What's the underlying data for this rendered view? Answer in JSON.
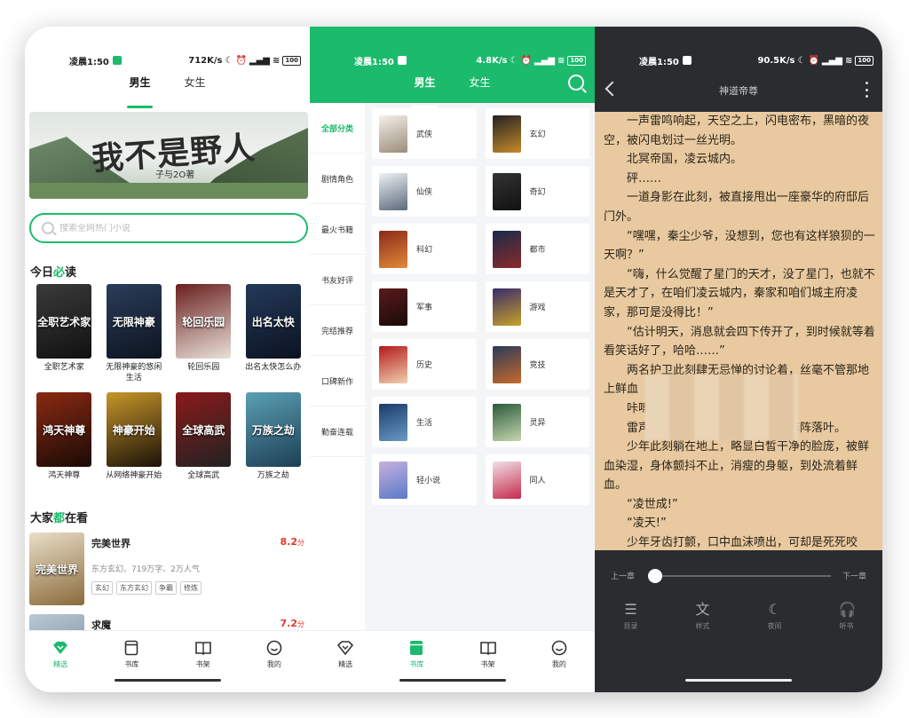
{
  "colors": {
    "accent": "#1cba6c",
    "score": "#e0392b",
    "reader_bg": "#e8c9a0",
    "reader_dark": "#2a2c30"
  },
  "panel1": {
    "status": {
      "time": "凌晨1:50",
      "speed": "712K/s",
      "battery": "100"
    },
    "tabs": [
      "男生",
      "女生"
    ],
    "banner": {
      "title": "我不是野人",
      "subtitle": "子与2O著"
    },
    "search_placeholder": "搜索全网热门小说",
    "today_title_a": "今日",
    "today_title_b": "必",
    "today_title_c": "读",
    "books": [
      {
        "name": "全职艺术家",
        "cover_text": "全职艺术家",
        "color1": "#3a3a3a",
        "color2": "#111111"
      },
      {
        "name": "无限神豪的悠闲生活",
        "cover_text": "无限神豪",
        "color1": "#2a3d5a",
        "color2": "#0d1420"
      },
      {
        "name": "轮回乐园",
        "cover_text": "轮回乐园",
        "color1": "#6a1f1f",
        "color2": "#e9e1d8"
      },
      {
        "name": "出名太快怎么办",
        "cover_text": "出名太快",
        "color1": "#243a5a",
        "color2": "#0a1220"
      },
      {
        "name": "鸿天神尊",
        "cover_text": "鸿天神尊",
        "color1": "#8a2a12",
        "color2": "#1a0a05"
      },
      {
        "name": "从网络神豪开始",
        "cover_text": "神豪开始",
        "color1": "#c7962a",
        "color2": "#1a1208"
      },
      {
        "name": "全球高武",
        "cover_text": "全球高武",
        "color1": "#8a1a1a",
        "color2": "#222222"
      },
      {
        "name": "万族之劫",
        "cover_text": "万族之劫",
        "color1": "#5aa0b4",
        "color2": "#1d3f55"
      }
    ],
    "everyone_title_a": "大家",
    "everyone_title_b": "都",
    "everyone_title_c": "在看",
    "hot": [
      {
        "title": "完美世界",
        "score": "8.2",
        "unit": "分",
        "meta": "东方玄幻、719万字、2万人气",
        "tags": [
          "玄幻",
          "东方玄幻",
          "争霸",
          "修炼"
        ],
        "cover_text": "完美世界",
        "color1": "#e9dfc8",
        "color2": "#8a6a3a"
      },
      {
        "title": "求魔",
        "score": "7.2",
        "unit": "分",
        "meta": "",
        "tags": [],
        "cover_text": "求魔",
        "color1": "#b9c9d6",
        "color2": "#6a7a8a"
      }
    ],
    "nav": [
      "精选",
      "书库",
      "书架",
      "我的"
    ]
  },
  "panel2": {
    "status": {
      "time": "凌晨1:50",
      "speed": "4.8K/s",
      "battery": "100"
    },
    "tabs": [
      "男生",
      "女生"
    ],
    "side": [
      "全部分类",
      "剧情角色",
      "最火书籍",
      "书友好评",
      "完结推荐",
      "口碑新作",
      "勤奋连载"
    ],
    "categories": [
      {
        "name": "武侠",
        "color1": "#f4f0ea",
        "color2": "#9a8c7a"
      },
      {
        "name": "玄幻",
        "color1": "#222222",
        "color2": "#c78a2a"
      },
      {
        "name": "仙侠",
        "color1": "#eef2f4",
        "color2": "#5a6a7a"
      },
      {
        "name": "奇幻",
        "color1": "#333333",
        "color2": "#111111"
      },
      {
        "name": "科幻",
        "color1": "#8a2a1a",
        "color2": "#e08a3a"
      },
      {
        "name": "都市",
        "color1": "#1a2a4a",
        "color2": "#8a2a2a"
      },
      {
        "name": "军事",
        "color1": "#5a1a1a",
        "color2": "#1a0a0a"
      },
      {
        "name": "游戏",
        "color1": "#3a2a6a",
        "color2": "#c7a22a"
      },
      {
        "name": "历史",
        "color1": "#b41a1a",
        "color2": "#f0d0b0"
      },
      {
        "name": "竞技",
        "color1": "#2a3a5a",
        "color2": "#c76a2a"
      },
      {
        "name": "生活",
        "color1": "#1a3a6a",
        "color2": "#6a9ac7"
      },
      {
        "name": "灵异",
        "color1": "#2a5a3a",
        "color2": "#c7d7b0"
      },
      {
        "name": "轻小说",
        "color1": "#c7b0e0",
        "color2": "#5a7ac7"
      },
      {
        "name": "同人",
        "color1": "#f0e0e8",
        "color2": "#c72a4a"
      }
    ],
    "nav": [
      "精选",
      "书库",
      "书架",
      "我的"
    ]
  },
  "panel3": {
    "status": {
      "time": "凌晨1:50",
      "speed": "90.5K/s",
      "battery": "100"
    },
    "title": "神道帝尊",
    "paragraphs": [
      "一声雷鸣响起，天空之上，闪电密布，黑暗的夜空，被闪电划过一丝光明。",
      "北冥帝国，凌云城内。",
      "砰……",
      "一道身影在此刻，被直接甩出一座豪华的府邸后门外。",
      "“嘿嘿，秦尘少爷，没想到，您也有这样狼狈的一天啊？”",
      "“嗨，什么觉醒了星门的天才，没了星门，也就不是天才了，在咱们凌云城内，秦家和咱们城主府凌家，那可是没得比！”",
      "“估计明天，消息就会四下传开了，到时候就等着看笑话好了，哈哈……”",
      "两名护卫此刻肆无忌惮的讨论着，丝毫不管那地上鲜血",
      "咔嚓",
      "雷声滚滚，大雨倾盆，狂风卷起阵阵落叶。",
      "少年此刻躺在地上，略显白皙干净的脸庞，被鲜血染湿，身体颤抖不止，消瘦的身躯，到处流着鲜血。",
      "“凌世成!”",
      "“凌天!”",
      "少年牙齿打颤，口中血沫喷出，可却是死死咬"
    ],
    "prev": "上一章",
    "next": "下一章",
    "progress": 0.0,
    "tools": [
      "目录",
      "样式",
      "夜间",
      "听书"
    ]
  }
}
